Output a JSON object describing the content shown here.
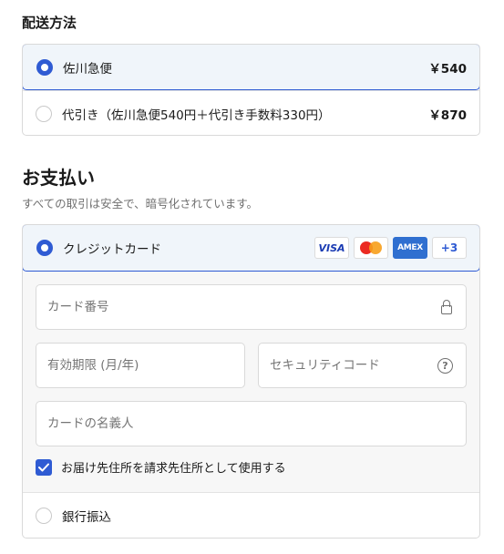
{
  "shipping": {
    "title": "配送方法",
    "options": [
      {
        "label": "佐川急便",
        "price": "￥540",
        "selected": true
      },
      {
        "label": "代引き（佐川急便540円＋代引き手数料330円）",
        "price": "￥870",
        "selected": false
      }
    ]
  },
  "payment": {
    "title": "お支払い",
    "subtitle": "すべての取引は安全で、暗号化されています。",
    "card": {
      "label": "クレジットカード",
      "selected": true,
      "brands": [
        "VISA",
        "AMEX",
        "+3"
      ],
      "brand_icons": [
        "visa-logo-icon",
        "mastercard-logo-icon",
        "amex-logo-icon"
      ],
      "number_placeholder": "カード番号",
      "expiry_placeholder": "有効期限 (月/年)",
      "cvc_placeholder": "セキュリティコード",
      "name_placeholder": "カードの名義人",
      "billing_same_label": "お届け先住所を請求先住所として使用する",
      "billing_same_checked": true
    },
    "bank": {
      "label": "銀行振込",
      "selected": false
    }
  },
  "colors": {
    "accent": "#2f5bd3",
    "selected_bg": "#f0f5fa",
    "border": "#d9d9d9",
    "muted_text": "#707070",
    "amex_blue": "#2f6fd0",
    "mastercard_red": "#eb2a22",
    "mastercard_orange": "#f79e1b"
  }
}
